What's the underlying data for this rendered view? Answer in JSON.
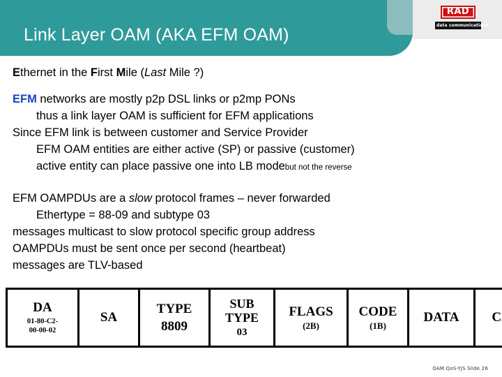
{
  "header": {
    "title": "Link Layer OAM (AKA EFM OAM)",
    "band_color": "#2f9a9a",
    "accent_color": "#8cbcbd",
    "logo": {
      "mark": "RAD",
      "tagline": "data communications",
      "mark_color": "#cc1111"
    }
  },
  "body": {
    "intro": {
      "prefix_e": "E",
      "text_1": "thernet in the ",
      "prefix_f": "F",
      "text_2": "irst ",
      "prefix_m": "M",
      "text_3": "ile (",
      "italic_last": "Last",
      "text_4": " Mile ?)"
    },
    "block_efm": {
      "acronym": "EFM",
      "line1_rest": " networks are mostly p2p DSL links or p2mp PONs",
      "line2": "thus a link layer OAM is sufficient for EFM applications",
      "line3": "Since EFM link is between customer and Service Provider",
      "line4": "EFM OAM entities are either active (SP) or passive (customer)",
      "line5": "active entity can place passive one into LB mode",
      "line5_note": "but not the reverse"
    },
    "block_oampdu": {
      "line1_pre": "EFM OAMPDUs are a ",
      "line1_italic": "slow",
      "line1_post": " protocol frames – never forwarded",
      "line2": "Ethertype = 88-09 and subtype 03",
      "line3": "messages multicast to slow protocol specific group address",
      "line4": "OAMPDUs must be sent once per second (heartbeat)",
      "line5": "messages are TLV-based"
    }
  },
  "frame_table": {
    "cells": [
      {
        "label": "DA",
        "sub": "01-80-C2-\n00-00-02",
        "sub_kind": "mac",
        "width": 98
      },
      {
        "label": "SA",
        "sub": "",
        "sub_kind": "none",
        "width": 82
      },
      {
        "label": "TYPE",
        "sub": "8809",
        "sub_kind": "val",
        "width": 96
      },
      {
        "label": "SUB\nTYPE",
        "sub": "03",
        "sub_kind": "val-sm",
        "width": 88
      },
      {
        "label": "FLAGS",
        "sub": "(2B)",
        "sub_kind": "bytes",
        "width": 100
      },
      {
        "label": "CODE",
        "sub": "(1B)",
        "sub_kind": "bytes",
        "width": 82
      },
      {
        "label": "DATA",
        "sub": "",
        "sub_kind": "none",
        "width": 90
      },
      {
        "label": "CRC",
        "sub": "",
        "sub_kind": "none",
        "width": 86
      }
    ]
  },
  "footer": {
    "text": "OAM QoS-YJS  Slide 26"
  }
}
